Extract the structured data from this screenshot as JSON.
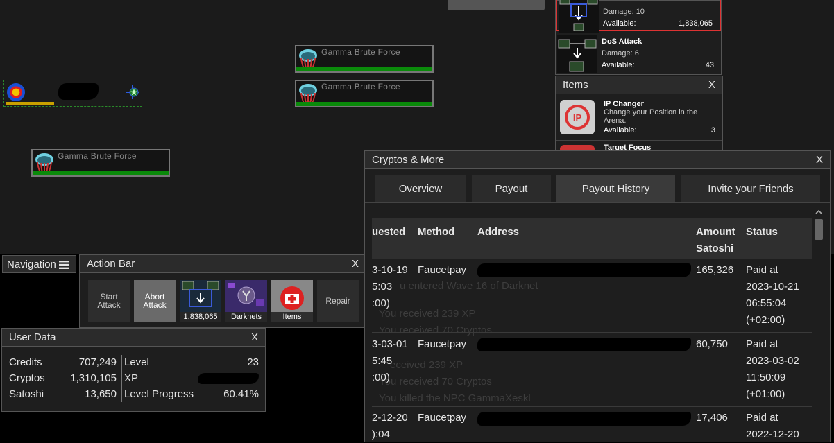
{
  "arena": {
    "enemies": [
      {
        "name": "Gamma Brute Force"
      },
      {
        "name": "Gamma Brute Force"
      },
      {
        "name": "Gamma Brute Force"
      }
    ]
  },
  "attacks": [
    {
      "title": "",
      "damage_label": "Damage: 10",
      "available_label": "Available:",
      "available": "1,838,065",
      "selected": true
    },
    {
      "title": "DoS Attack",
      "damage_label": "Damage: 6",
      "available_label": "Available:",
      "available": "43",
      "selected": false
    }
  ],
  "items_window": {
    "title": "Items",
    "close": "X",
    "items": [
      {
        "title": "IP Changer",
        "desc": "Change your Position in the Arena.",
        "available_label": "Available:",
        "available": "3"
      },
      {
        "title": "Target Focus",
        "desc": "",
        "available_label": "",
        "available": ""
      }
    ]
  },
  "navigation": {
    "label": "Navigation",
    "icon": "hamburger-icon"
  },
  "action_bar": {
    "title": "Action Bar",
    "close": "X",
    "start": "Start Attack",
    "abort": "Abort Attack",
    "attack_count": "1,838,065",
    "darknets": "Darknets",
    "items": "Items",
    "repair": "Repair"
  },
  "user_data": {
    "title": "User Data",
    "close": "X",
    "credits_label": "Credits",
    "credits": "707,249",
    "cryptos_label": "Cryptos",
    "cryptos": "1,310,105",
    "satoshi_label": "Satoshi",
    "satoshi": "13,650",
    "level_label": "Level",
    "level": "23",
    "xp_label": "XP",
    "progress_label": "Level Progress",
    "progress": "60.41%"
  },
  "cryptos_window": {
    "title": "Cryptos & More",
    "close": "X",
    "tabs": [
      "Overview",
      "Payout",
      "Payout History",
      "Invite your Friends"
    ],
    "active_tab": 2,
    "headers": {
      "requested": "uested",
      "method": "Method",
      "address": "Address",
      "amount": "Amount",
      "amount2": "Satoshi",
      "status": "Status"
    },
    "rows": [
      {
        "date1": "3-10-19",
        "date2": "5:03",
        "date3": ":00)",
        "method": "Faucetpay",
        "amount": "165,326",
        "status1": "Paid at",
        "status2": "2023-10-21",
        "status3": "06:55:04",
        "status4": "(+02:00)"
      },
      {
        "date1": "3-03-01",
        "date2": "5:45",
        "date3": ":00)",
        "method": "Faucetpay",
        "amount": "60,750",
        "status1": "Paid at",
        "status2": "2023-03-02",
        "status3": "11:50:09",
        "status4": "(+01:00)"
      },
      {
        "date1": "2-12-20",
        "date2": "):04",
        "date3": "",
        "method": "Faucetpay",
        "amount": "17,406",
        "status1": "Paid at",
        "status2": "2022-12-20",
        "status3": "",
        "status4": ""
      }
    ],
    "ghost_log": [
      "u entered Wave 16 of Darknet",
      "You received 239 XP",
      "You received 70 Cryptos",
      "eceived 239 XP",
      "You received 70 Cryptos",
      "You killed the NPC GammaXeskl"
    ]
  }
}
